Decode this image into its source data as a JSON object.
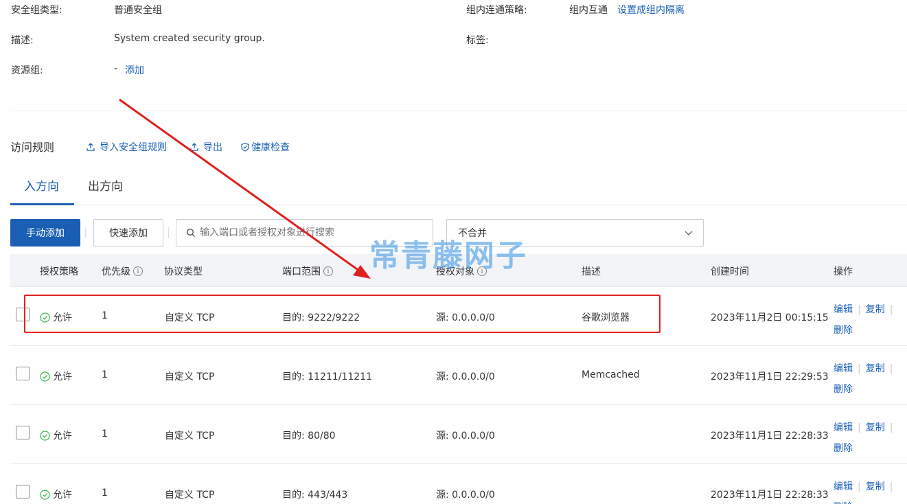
{
  "info": {
    "sg_type_label": "安全组类型:",
    "sg_type_value": "普通安全组",
    "policy_label": "组内连通策略:",
    "policy_value": "组内互通",
    "policy_link": "设置成组内隔离",
    "desc_label": "描述:",
    "desc_value": "System created security group.",
    "tags_label": "标签:",
    "rg_label": "资源组:",
    "rg_value": "-",
    "rg_link": "添加"
  },
  "rules_section": {
    "title": "访问规则",
    "import_label": "导入安全组规则",
    "export_label": "导出",
    "health_label": "健康检查"
  },
  "tabs": [
    {
      "label": "入方向",
      "active": true
    },
    {
      "label": "出方向",
      "active": false
    }
  ],
  "toolbar": {
    "manual_add": "手动添加",
    "quick_add": "快速添加",
    "search_placeholder": "输入端口或者授权对象进行搜索",
    "merge_select": "不合并"
  },
  "table": {
    "headers": {
      "policy": "授权策略",
      "priority": "优先级",
      "protocol": "协议类型",
      "port": "端口范围",
      "source": "授权对象",
      "desc": "描述",
      "created": "创建时间",
      "ops": "操作"
    },
    "rows": [
      {
        "policy": "允许",
        "priority": "1",
        "protocol": "自定义 TCP",
        "port": "目的: 9222/9222",
        "source": "源: 0.0.0.0/0",
        "desc": "谷歌浏览器",
        "created": "2023年11月2日 00:15:15",
        "edit": "编辑",
        "copy": "复制",
        "delete": "删除"
      },
      {
        "policy": "允许",
        "priority": "1",
        "protocol": "自定义 TCP",
        "port": "目的: 11211/11211",
        "source": "源: 0.0.0.0/0",
        "desc": "Memcached",
        "created": "2023年11月1日 22:29:53",
        "edit": "编辑",
        "copy": "复制",
        "delete": "删除"
      },
      {
        "policy": "允许",
        "priority": "1",
        "protocol": "自定义 TCP",
        "port": "目的: 80/80",
        "source": "源: 0.0.0.0/0",
        "desc": "",
        "created": "2023年11月1日 22:28:33",
        "edit": "编辑",
        "copy": "复制",
        "delete": "删除"
      },
      {
        "policy": "允许",
        "priority": "1",
        "protocol": "自定义 TCP",
        "port": "目的: 443/443",
        "source": "源: 0.0.0.0/0",
        "desc": "",
        "created": "2023年11月1日 22:28:33",
        "edit": "编辑",
        "copy": "复制",
        "delete": "删除"
      }
    ]
  },
  "watermark": "常青藤网子",
  "colors": {
    "accent": "#1a5fb4",
    "annotation": "#e02020",
    "allow_icon": "#3bb54a"
  }
}
